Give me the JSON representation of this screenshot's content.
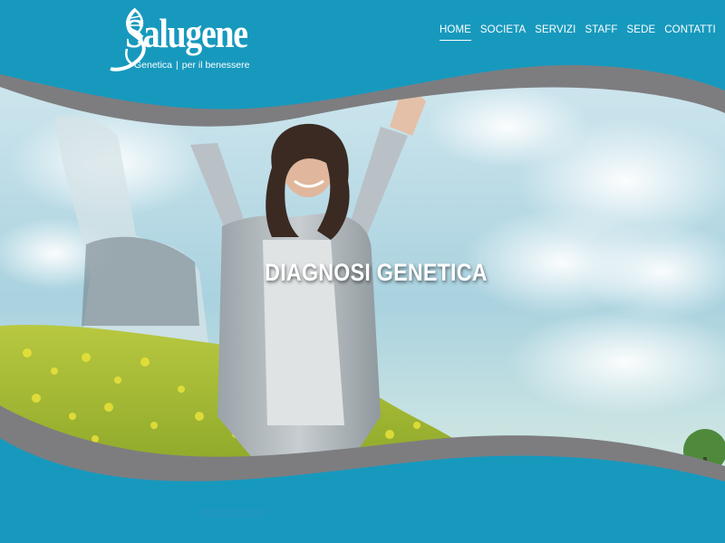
{
  "brand": {
    "name": "Salugene",
    "tagline_left": "Genetica",
    "tagline_right": "per il benessere"
  },
  "nav": {
    "items": [
      {
        "label": "HOME",
        "active": true
      },
      {
        "label": "SOCIETA",
        "active": false
      },
      {
        "label": "SERVIZI",
        "active": false
      },
      {
        "label": "STAFF",
        "active": false
      },
      {
        "label": "SEDE",
        "active": false
      },
      {
        "label": "CONTATTI",
        "active": false
      }
    ]
  },
  "hero": {
    "title": "DIAGNOSI GENETICA"
  },
  "colors": {
    "background": "#1799be",
    "wave_gray": "#7d7d80",
    "text": "#ffffff"
  }
}
